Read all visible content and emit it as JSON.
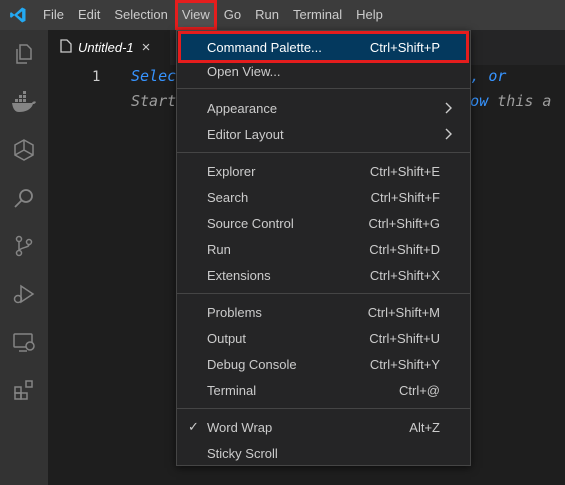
{
  "menubar": {
    "items": [
      "File",
      "Edit",
      "Selection",
      "View",
      "Go",
      "Run",
      "Terminal",
      "Help"
    ],
    "active_index": 3
  },
  "tab": {
    "label": "Untitled-1",
    "close": "×"
  },
  "editor": {
    "line_number": "1",
    "hint_line1_left": "Selec",
    "hint_line1_right": "mplate, or",
    "hint_line2_left": "Start",
    "hint_line2_right_link": "how",
    "hint_line2_right_rest": " this a"
  },
  "view_menu": {
    "command_palette": {
      "label": "Command Palette...",
      "shortcut": "Ctrl+Shift+P"
    },
    "open_view": {
      "label": "Open View..."
    },
    "appearance": {
      "label": "Appearance"
    },
    "editor_layout": {
      "label": "Editor Layout"
    },
    "explorer": {
      "label": "Explorer",
      "shortcut": "Ctrl+Shift+E"
    },
    "search": {
      "label": "Search",
      "shortcut": "Ctrl+Shift+F"
    },
    "source_control": {
      "label": "Source Control",
      "shortcut": "Ctrl+Shift+G"
    },
    "run": {
      "label": "Run",
      "shortcut": "Ctrl+Shift+D"
    },
    "extensions": {
      "label": "Extensions",
      "shortcut": "Ctrl+Shift+X"
    },
    "problems": {
      "label": "Problems",
      "shortcut": "Ctrl+Shift+M"
    },
    "output": {
      "label": "Output",
      "shortcut": "Ctrl+Shift+U"
    },
    "debug_console": {
      "label": "Debug Console",
      "shortcut": "Ctrl+Shift+Y"
    },
    "terminal": {
      "label": "Terminal",
      "shortcut": "Ctrl+@"
    },
    "word_wrap": {
      "label": "Word Wrap",
      "shortcut": "Alt+Z",
      "checked": true,
      "check": "✓"
    },
    "sticky_scroll": {
      "label": "Sticky Scroll"
    }
  },
  "colors": {
    "accent": "#007acc",
    "highlight_border": "#e51d1d",
    "selected_bg": "#04395e"
  }
}
